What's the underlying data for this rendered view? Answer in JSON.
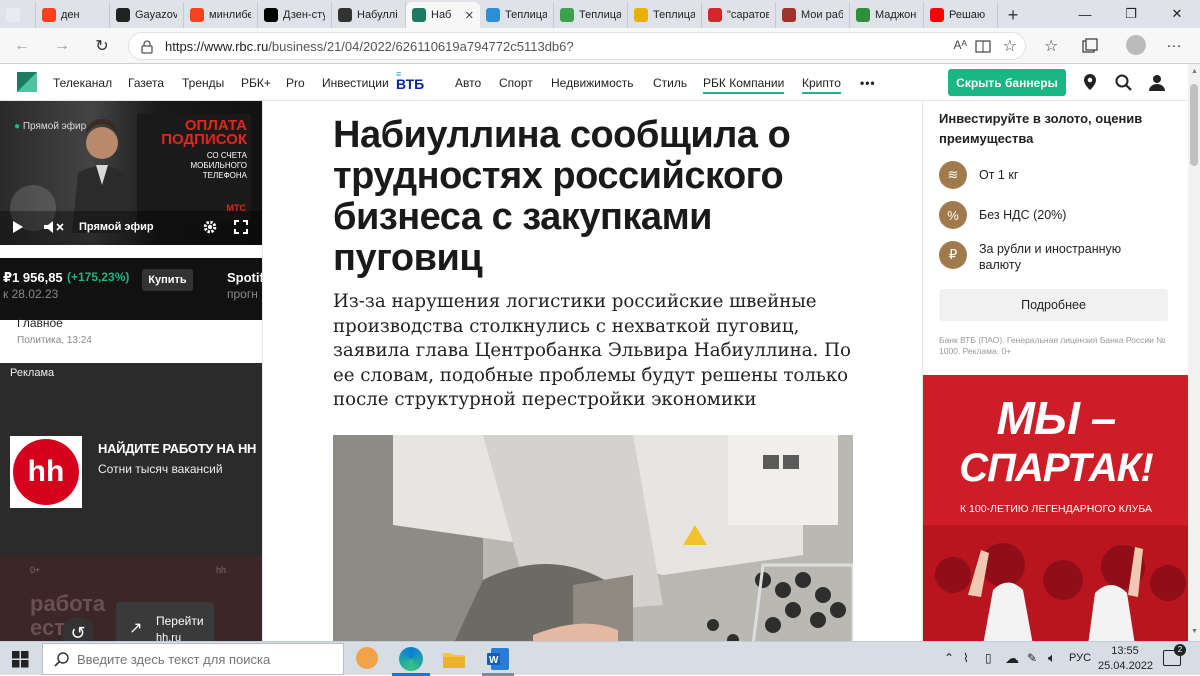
{
  "browser": {
    "tabs": [
      {
        "title": "",
        "icon": "blank-page-icon",
        "color": "#e9ecef"
      },
      {
        "title": "ден",
        "icon": "yandex-icon",
        "color": "#fc3f1d"
      },
      {
        "title": "Gayazov",
        "icon": "play-icon",
        "color": "#222222"
      },
      {
        "title": "минлибе",
        "icon": "yandex-icon",
        "color": "#fc3f1d"
      },
      {
        "title": "Дзен-сту",
        "icon": "zen-icon",
        "color": "#000000"
      },
      {
        "title": "Набуллі",
        "icon": "letter-l-icon",
        "color": "#333333"
      },
      {
        "title": "Наб",
        "icon": "rbc-icon",
        "color": "#1f7a63"
      },
      {
        "title": "Теплица",
        "icon": "teplitsa-icon",
        "color": "#2a8fd4"
      },
      {
        "title": "Теплица",
        "icon": "teplitsa-icon",
        "color": "#3ca14a"
      },
      {
        "title": "Теплица",
        "icon": "teplitsa-icon",
        "color": "#e8b000"
      },
      {
        "title": "\"саратов",
        "icon": "copyright-icon",
        "color": "#d6262c"
      },
      {
        "title": "Мои раб",
        "icon": "tr-icon",
        "color": "#a0322c"
      },
      {
        "title": "Маджон",
        "icon": "mahjong-icon",
        "color": "#2f8f3a"
      },
      {
        "title": "Решаю",
        "icon": "youtube-icon",
        "color": "#ff0000"
      }
    ],
    "new_tab_label": "+",
    "url_prefix": "https://www.rbc.ru",
    "url_path": "/business/21/04/2022/626110619a794772c5113db6?",
    "window_controls": [
      "—",
      "❐",
      "✕"
    ]
  },
  "site_nav": {
    "items": [
      "Телеканал",
      "Газета",
      "Тренды",
      "РБК+",
      "Pro",
      "Инвестиции",
      "Авто",
      "Спорт",
      "Недвижимость",
      "Стиль",
      "РБК Компании",
      "Крипто"
    ],
    "vtb_label": "ВТБ",
    "more_label": "•••",
    "hide_banners_label": "Скрыть баннеры",
    "brand_color": "#1f7a63",
    "accent_color": "#18b784"
  },
  "left": {
    "live_badge": "Прямой эфир",
    "video_ad_title": "Оплата подписок",
    "video_ad_subtitle": "со счета мобильного телефона",
    "video_ad_brand": "МТС",
    "live_label": "Прямой эфир",
    "ticker_value": "₽1 956,85",
    "ticker_change": "(+175,23%)",
    "ticker_date": "к 28.02.23",
    "buy_label": "Купить",
    "spotify_label": "Spotif",
    "forecast_label": "прогн",
    "news_title": "Главное",
    "news_meta": "Политика, 13:24",
    "ad_label": "Реклама",
    "hh_logo": "hh",
    "hh_title": "НАЙДИТЕ РАБОТУ НА НН",
    "hh_subtitle": "Сотни тысяч вакансий",
    "dim_text_1": "работа",
    "dim_text_2": "есть",
    "goto_label": "Перейти",
    "goto_domain": "hh.ru",
    "dim_age": "0+",
    "dim_hh": "hh"
  },
  "article": {
    "headline": "Набиуллина сообщила о трудностях российского бизнеса с закупками пуговиц",
    "lede": "Из-за нарушения логистики российские швейные производства столкнулись с нехваткой пуговиц, заявила глава Центробанка Эльвира Набиуллина. По ее словам, подобные проблемы будут решены только после структурной перестройки экономики"
  },
  "right": {
    "promo_title": "Инвестируйте в золото, оценив преимущества",
    "features": [
      "От 1 кг",
      "Без НДС (20%)",
      "За рубли и иностранную валюту"
    ],
    "more_button": "Подробнее",
    "disclaimer": "Банк ВТБ (ПАО). Генеральная лицензия Банка России № 1000. Реклама. 0+",
    "spartak_line1": "МЫ –",
    "spartak_line2": "СПАРТАК!",
    "spartak_sub": "К 100-ЛЕТИЮ ЛЕГЕНДАРНОГО КЛУБА",
    "gold_icon_color": "#a07a4c",
    "spartak_color": "#d41f2a"
  },
  "taskbar": {
    "search_placeholder": "Введите здесь текст для поиска",
    "language": "РУС",
    "time": "13:55",
    "date": "25.04.2022",
    "notification_count": "2"
  }
}
